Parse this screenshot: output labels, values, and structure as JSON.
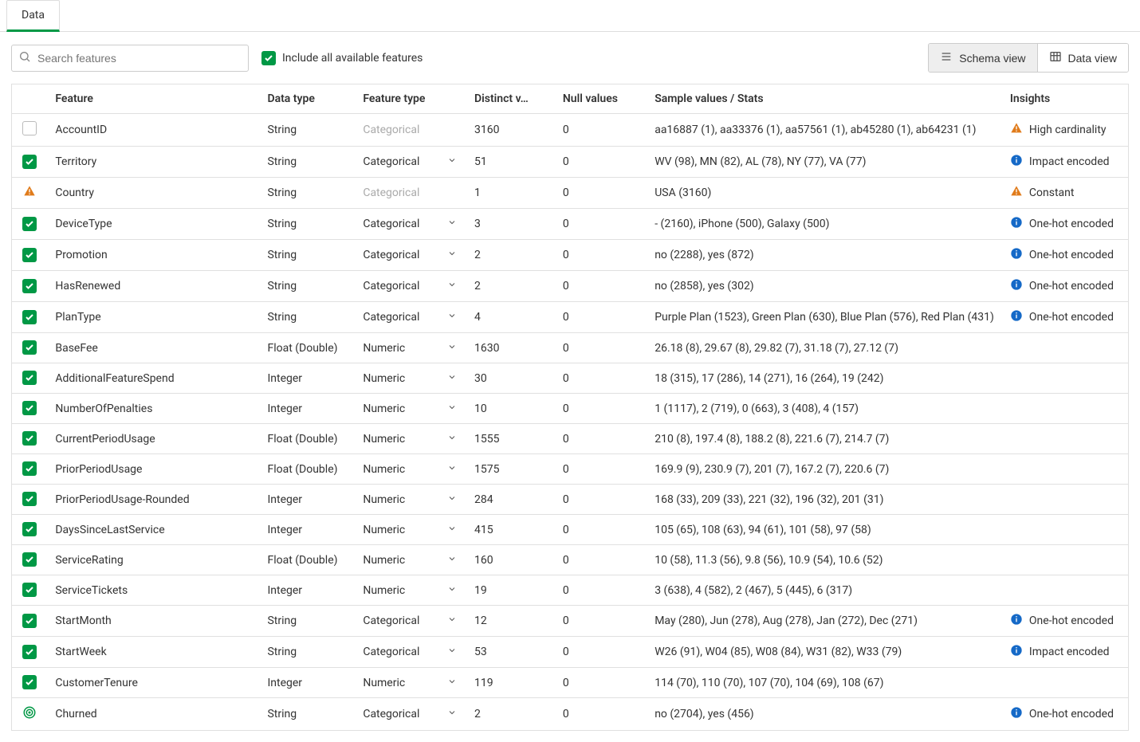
{
  "tab": {
    "label": "Data"
  },
  "toolbar": {
    "search_placeholder": "Search features",
    "include_label": "Include all available features",
    "schema_view_label": "Schema view",
    "data_view_label": "Data view"
  },
  "columns": {
    "feature": "Feature",
    "data_type": "Data type",
    "feature_type": "Feature type",
    "distinct": "Distinct v…",
    "nulls": "Null values",
    "sample": "Sample values / Stats",
    "insights": "Insights"
  },
  "rows": [
    {
      "status": "unchecked",
      "feature": "AccountID",
      "data_type": "String",
      "feature_type": "Categorical",
      "ftype_enabled": false,
      "distinct": "3160",
      "nulls": "0",
      "sample": "aa16887 (1), aa33376 (1), aa57561 (1), ab45280 (1), ab64231 (1)",
      "insight_icon": "warn",
      "insight_text": "High cardinality"
    },
    {
      "status": "checked",
      "feature": "Territory",
      "data_type": "String",
      "feature_type": "Categorical",
      "ftype_enabled": true,
      "distinct": "51",
      "nulls": "0",
      "sample": "WV (98), MN (82), AL (78), NY (77), VA (77)",
      "insight_icon": "info",
      "insight_text": "Impact encoded"
    },
    {
      "status": "warn",
      "feature": "Country",
      "data_type": "String",
      "feature_type": "Categorical",
      "ftype_enabled": false,
      "distinct": "1",
      "nulls": "0",
      "sample": "USA (3160)",
      "insight_icon": "warn",
      "insight_text": "Constant"
    },
    {
      "status": "checked",
      "feature": "DeviceType",
      "data_type": "String",
      "feature_type": "Categorical",
      "ftype_enabled": true,
      "distinct": "3",
      "nulls": "0",
      "sample": "- (2160), iPhone (500), Galaxy (500)",
      "insight_icon": "info",
      "insight_text": "One-hot encoded"
    },
    {
      "status": "checked",
      "feature": "Promotion",
      "data_type": "String",
      "feature_type": "Categorical",
      "ftype_enabled": true,
      "distinct": "2",
      "nulls": "0",
      "sample": "no (2288), yes (872)",
      "insight_icon": "info",
      "insight_text": "One-hot encoded"
    },
    {
      "status": "checked",
      "feature": "HasRenewed",
      "data_type": "String",
      "feature_type": "Categorical",
      "ftype_enabled": true,
      "distinct": "2",
      "nulls": "0",
      "sample": "no (2858), yes (302)",
      "insight_icon": "info",
      "insight_text": "One-hot encoded"
    },
    {
      "status": "checked",
      "feature": "PlanType",
      "data_type": "String",
      "feature_type": "Categorical",
      "ftype_enabled": true,
      "distinct": "4",
      "nulls": "0",
      "sample": "Purple Plan (1523), Green Plan (630), Blue Plan (576), Red Plan (431)",
      "insight_icon": "info",
      "insight_text": "One-hot encoded"
    },
    {
      "status": "checked",
      "feature": "BaseFee",
      "data_type": "Float (Double)",
      "feature_type": "Numeric",
      "ftype_enabled": true,
      "distinct": "1630",
      "nulls": "0",
      "sample": "26.18 (8), 29.67 (8), 29.82 (7), 31.18 (7), 27.12 (7)",
      "insight_icon": "",
      "insight_text": ""
    },
    {
      "status": "checked",
      "feature": "AdditionalFeatureSpend",
      "data_type": "Integer",
      "feature_type": "Numeric",
      "ftype_enabled": true,
      "distinct": "30",
      "nulls": "0",
      "sample": "18 (315), 17 (286), 14 (271), 16 (264), 19 (242)",
      "insight_icon": "",
      "insight_text": ""
    },
    {
      "status": "checked",
      "feature": "NumberOfPenalties",
      "data_type": "Integer",
      "feature_type": "Numeric",
      "ftype_enabled": true,
      "distinct": "10",
      "nulls": "0",
      "sample": "1 (1117), 2 (719), 0 (663), 3 (408), 4 (157)",
      "insight_icon": "",
      "insight_text": ""
    },
    {
      "status": "checked",
      "feature": "CurrentPeriodUsage",
      "data_type": "Float (Double)",
      "feature_type": "Numeric",
      "ftype_enabled": true,
      "distinct": "1555",
      "nulls": "0",
      "sample": "210 (8), 197.4 (8), 188.2 (8), 221.6 (7), 214.7 (7)",
      "insight_icon": "",
      "insight_text": ""
    },
    {
      "status": "checked",
      "feature": "PriorPeriodUsage",
      "data_type": "Float (Double)",
      "feature_type": "Numeric",
      "ftype_enabled": true,
      "distinct": "1575",
      "nulls": "0",
      "sample": "169.9 (9), 230.9 (7), 201 (7), 167.2 (7), 220.6 (7)",
      "insight_icon": "",
      "insight_text": ""
    },
    {
      "status": "checked",
      "feature": "PriorPeriodUsage-Rounded",
      "data_type": "Integer",
      "feature_type": "Numeric",
      "ftype_enabled": true,
      "distinct": "284",
      "nulls": "0",
      "sample": "168 (33), 209 (33), 221 (32), 196 (32), 201 (31)",
      "insight_icon": "",
      "insight_text": ""
    },
    {
      "status": "checked",
      "feature": "DaysSinceLastService",
      "data_type": "Integer",
      "feature_type": "Numeric",
      "ftype_enabled": true,
      "distinct": "415",
      "nulls": "0",
      "sample": "105 (65), 108 (63), 94 (61), 101 (58), 97 (58)",
      "insight_icon": "",
      "insight_text": ""
    },
    {
      "status": "checked",
      "feature": "ServiceRating",
      "data_type": "Float (Double)",
      "feature_type": "Numeric",
      "ftype_enabled": true,
      "distinct": "160",
      "nulls": "0",
      "sample": "10 (58), 11.3 (56), 9.8 (56), 10.9 (54), 10.6 (52)",
      "insight_icon": "",
      "insight_text": ""
    },
    {
      "status": "checked",
      "feature": "ServiceTickets",
      "data_type": "Integer",
      "feature_type": "Numeric",
      "ftype_enabled": true,
      "distinct": "19",
      "nulls": "0",
      "sample": "3 (638), 4 (582), 2 (467), 5 (445), 6 (317)",
      "insight_icon": "",
      "insight_text": ""
    },
    {
      "status": "checked",
      "feature": "StartMonth",
      "data_type": "String",
      "feature_type": "Categorical",
      "ftype_enabled": true,
      "distinct": "12",
      "nulls": "0",
      "sample": "May (280), Jun (278), Aug (278), Jan (272), Dec (271)",
      "insight_icon": "info",
      "insight_text": "One-hot encoded"
    },
    {
      "status": "checked",
      "feature": "StartWeek",
      "data_type": "String",
      "feature_type": "Categorical",
      "ftype_enabled": true,
      "distinct": "53",
      "nulls": "0",
      "sample": "W26 (91), W04 (85), W08 (84), W31 (82), W33 (79)",
      "insight_icon": "info",
      "insight_text": "Impact encoded"
    },
    {
      "status": "checked",
      "feature": "CustomerTenure",
      "data_type": "Integer",
      "feature_type": "Numeric",
      "ftype_enabled": true,
      "distinct": "119",
      "nulls": "0",
      "sample": "114 (70), 110 (70), 107 (70), 104 (69), 108 (67)",
      "insight_icon": "",
      "insight_text": ""
    },
    {
      "status": "target",
      "feature": "Churned",
      "data_type": "String",
      "feature_type": "Categorical",
      "ftype_enabled": true,
      "distinct": "2",
      "nulls": "0",
      "sample": "no (2704), yes (456)",
      "insight_icon": "info",
      "insight_text": "One-hot encoded"
    }
  ]
}
